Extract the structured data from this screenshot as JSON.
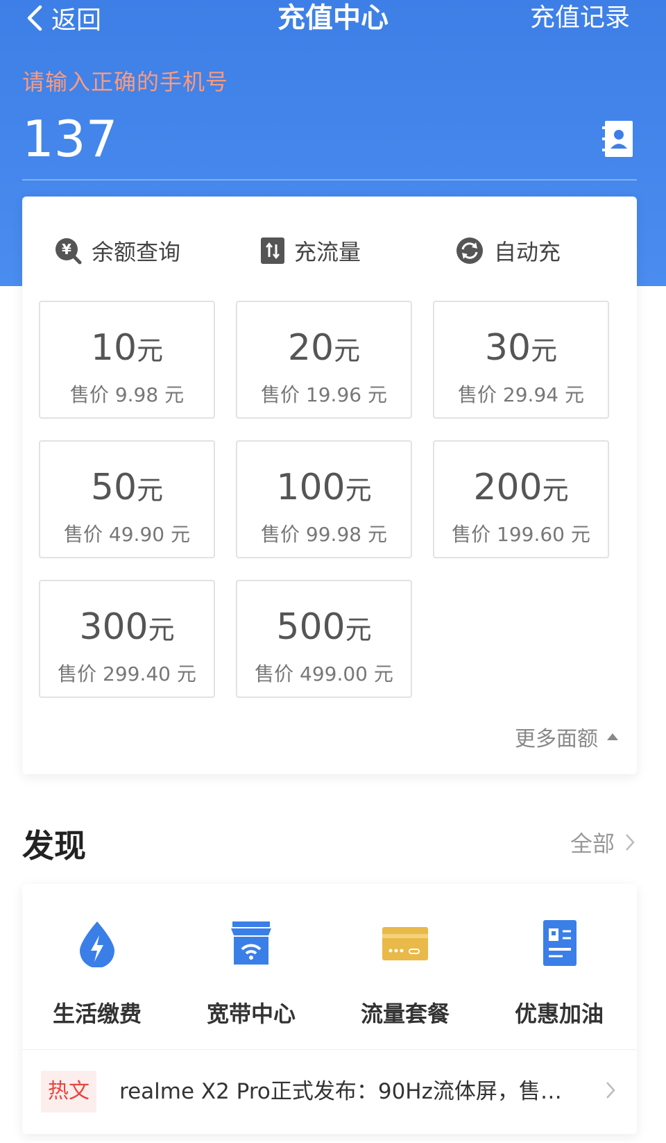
{
  "nav": {
    "back_label": "返回",
    "title": "充值中心",
    "history_label": "充值记录"
  },
  "phone": {
    "hint": "请输入正确的手机号",
    "value": "137"
  },
  "quick_actions": [
    {
      "label": "余额查询",
      "icon": "yuan-search-icon"
    },
    {
      "label": "充流量",
      "icon": "data-transfer-icon"
    },
    {
      "label": "自动充",
      "icon": "refresh-cycle-icon"
    }
  ],
  "denominations": [
    {
      "amount": "10",
      "unit": "元",
      "price": "售价 9.98 元"
    },
    {
      "amount": "20",
      "unit": "元",
      "price": "售价 19.96 元"
    },
    {
      "amount": "30",
      "unit": "元",
      "price": "售价 29.94 元"
    },
    {
      "amount": "50",
      "unit": "元",
      "price": "售价 49.90 元"
    },
    {
      "amount": "100",
      "unit": "元",
      "price": "售价 99.98 元"
    },
    {
      "amount": "200",
      "unit": "元",
      "price": "售价 199.60 元"
    },
    {
      "amount": "300",
      "unit": "元",
      "price": "售价 299.40 元"
    },
    {
      "amount": "500",
      "unit": "元",
      "price": "售价 499.00 元"
    }
  ],
  "more_label": "更多面额",
  "discover": {
    "title": "发现",
    "all_label": "全部",
    "services": [
      {
        "label": "生活缴费",
        "icon": "water-drop-bolt-icon"
      },
      {
        "label": "宽带中心",
        "icon": "wifi-store-icon"
      },
      {
        "label": "流量套餐",
        "icon": "data-card-icon"
      },
      {
        "label": "优惠加油",
        "icon": "gas-station-icon"
      }
    ],
    "news": {
      "badge": "热文",
      "text": "realme X2 Pro正式发布：90Hz流体屏，售…"
    }
  },
  "colors": {
    "header_blue": "#3d7fe6",
    "hint_orange": "#ff9a7a",
    "icon_blue": "#3a7fe8",
    "icon_gold": "#e9b949",
    "hot_red": "#e8453c"
  }
}
